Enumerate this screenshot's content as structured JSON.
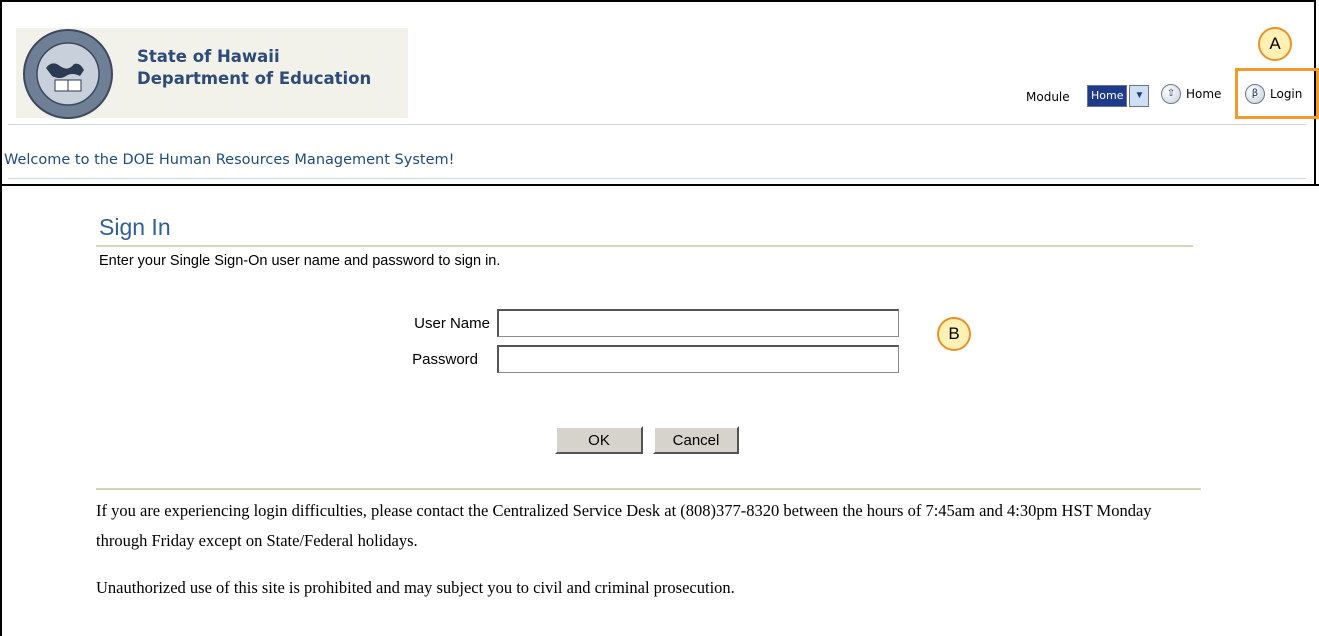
{
  "header": {
    "org_line1": "State of Hawaii",
    "org_line2": "Department of Education",
    "module_label": "Module",
    "module_selected": "Home",
    "home_link": "Home",
    "login_link": "Login",
    "welcome": "Welcome to the DOE Human Resources Management System!"
  },
  "callouts": {
    "a": "A",
    "b": "B"
  },
  "signin": {
    "title": "Sign In",
    "instructions": "Enter your Single Sign-On user name and password to sign in.",
    "username_label": "User Name",
    "password_label": "Password",
    "username_value": "",
    "password_value": "",
    "ok_label": "OK",
    "cancel_label": "Cancel"
  },
  "footer": {
    "help_text": "If you are experiencing login difficulties, please contact the Centralized Service Desk at (808)377-8320 between the hours of 7:45am and 4:30pm HST Monday through Friday except on State/Federal holidays.",
    "warning_text": "Unauthorized use of this site is prohibited and may subject you to civil and criminal prosecution."
  },
  "colors": {
    "accent": "#2f5f93",
    "highlight": "#f29a2e",
    "callout_fill": "#fff0b3"
  }
}
